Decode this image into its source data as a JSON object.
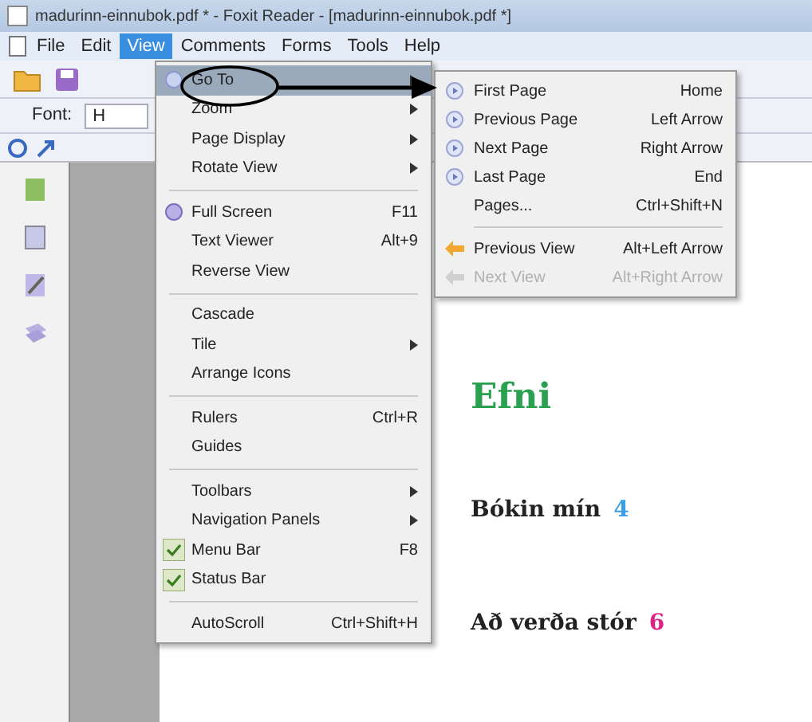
{
  "window": {
    "title": "madurinn-einnubok.pdf * - Foxit Reader - [madurinn-einnubok.pdf *]"
  },
  "menubar": [
    {
      "label": "File",
      "selected": false
    },
    {
      "label": "Edit",
      "selected": false
    },
    {
      "label": "View",
      "selected": true
    },
    {
      "label": "Comments",
      "selected": false
    },
    {
      "label": "Forms",
      "selected": false
    },
    {
      "label": "Tools",
      "selected": false
    },
    {
      "label": "Help",
      "selected": false
    }
  ],
  "font_bar": {
    "label": "Font:",
    "value": "H"
  },
  "view_menu": [
    {
      "kind": "item",
      "label": "Go To",
      "submenu": true,
      "selected": true,
      "checked": false
    },
    {
      "kind": "item",
      "label": "Zoom",
      "submenu": true,
      "selected": false,
      "checked": false
    },
    {
      "kind": "item",
      "label": "Page Display",
      "submenu": true,
      "selected": false,
      "checked": false
    },
    {
      "kind": "item",
      "label": "Rotate View",
      "submenu": true,
      "selected": false,
      "checked": false
    },
    {
      "kind": "separator"
    },
    {
      "kind": "item",
      "label": "Full Screen",
      "shortcut": "F11",
      "submenu": false,
      "selected": false,
      "checked": false
    },
    {
      "kind": "item",
      "label": "Text Viewer",
      "shortcut": "Alt+9",
      "submenu": false,
      "selected": false,
      "checked": false
    },
    {
      "kind": "item",
      "label": "Reverse View",
      "submenu": false,
      "selected": false,
      "checked": false
    },
    {
      "kind": "separator"
    },
    {
      "kind": "item",
      "label": "Cascade",
      "submenu": false,
      "selected": false,
      "checked": false
    },
    {
      "kind": "item",
      "label": "Tile",
      "submenu": true,
      "selected": false,
      "checked": false
    },
    {
      "kind": "item",
      "label": "Arrange Icons",
      "submenu": false,
      "selected": false,
      "checked": false
    },
    {
      "kind": "separator"
    },
    {
      "kind": "item",
      "label": "Rulers",
      "shortcut": "Ctrl+R",
      "submenu": false,
      "selected": false,
      "checked": false
    },
    {
      "kind": "item",
      "label": "Guides",
      "submenu": false,
      "selected": false,
      "checked": false
    },
    {
      "kind": "separator"
    },
    {
      "kind": "item",
      "label": "Toolbars",
      "submenu": true,
      "selected": false,
      "checked": false
    },
    {
      "kind": "item",
      "label": "Navigation Panels",
      "submenu": true,
      "selected": false,
      "checked": false
    },
    {
      "kind": "item",
      "label": "Menu Bar",
      "shortcut": "F8",
      "submenu": false,
      "selected": false,
      "checked": true
    },
    {
      "kind": "item",
      "label": "Status Bar",
      "submenu": false,
      "selected": false,
      "checked": true
    },
    {
      "kind": "separator"
    },
    {
      "kind": "item",
      "label": "AutoScroll",
      "shortcut": "Ctrl+Shift+H",
      "submenu": false,
      "selected": false,
      "checked": false
    }
  ],
  "goto_submenu": [
    {
      "kind": "item",
      "label": "First Page",
      "shortcut": "Home",
      "disabled": false
    },
    {
      "kind": "item",
      "label": "Previous Page",
      "shortcut": "Left Arrow",
      "disabled": false
    },
    {
      "kind": "item",
      "label": "Next Page",
      "shortcut": "Right Arrow",
      "disabled": false
    },
    {
      "kind": "item",
      "label": "Last Page",
      "shortcut": "End",
      "disabled": false
    },
    {
      "kind": "item",
      "label": "Pages...",
      "shortcut": "Ctrl+Shift+N",
      "disabled": false
    },
    {
      "kind": "separator"
    },
    {
      "kind": "item",
      "label": "Previous View",
      "shortcut": "Alt+Left Arrow",
      "disabled": false
    },
    {
      "kind": "item",
      "label": "Next View",
      "shortcut": "Alt+Right Arrow",
      "disabled": true
    }
  ],
  "document": {
    "heading": "Efni",
    "entries": [
      {
        "title": "Bókin mín",
        "page": "4",
        "color": "#3a9ee8"
      },
      {
        "title": "Að verða stór",
        "page": "6",
        "color": "#e0218a"
      }
    ]
  }
}
